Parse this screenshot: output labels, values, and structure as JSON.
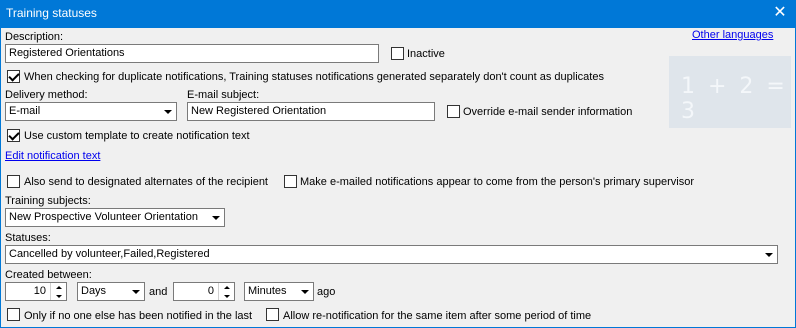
{
  "window": {
    "title": "Training statuses"
  },
  "form": {
    "description_label": "Description:",
    "description_value": "Registered Orientations",
    "inactive_label": "Inactive",
    "other_languages_link": "Other languages",
    "logo_text": "1 + 2 = 3",
    "duplicate_label": "When checking for duplicate notifications, Training statuses notifications generated separately don't count as duplicates",
    "delivery_label": "Delivery method:",
    "delivery_value": "E-mail",
    "subject_label": "E-mail subject:",
    "subject_value": "New Registered Orientation",
    "override_label": "Override e-mail sender information",
    "custom_template_label": "Use custom template to create notification text",
    "edit_text_link": "Edit notification text",
    "alternates_label": "Also send to designated alternates of the recipient",
    "supervisor_label": "Make e-mailed notifications appear to come from the person's primary supervisor",
    "training_subjects_label": "Training subjects:",
    "training_subjects_value": "New Prospective Volunteer Orientation",
    "statuses_label": "Statuses:",
    "statuses_value": "Cancelled by volunteer,Failed,Registered",
    "created_between_label": "Created between:",
    "from_value": "10",
    "from_unit": "Days",
    "and_label": "and",
    "to_value": "0",
    "to_unit": "Minutes",
    "ago_label": "ago",
    "only_if_label": "Only if no one else has been notified in the last",
    "allow_renotify_label": "Allow re-notification for the same item after some period of time"
  },
  "state": {
    "inactive": false,
    "duplicate": true,
    "override": false,
    "custom_template": true,
    "alternates": false,
    "supervisor": false,
    "only_if": false,
    "allow_renotify": false
  },
  "colors": {
    "titlebar": "#0078d7",
    "client": "#f0f0f0",
    "link": "#0000ee"
  },
  "icons": {
    "close": "close-icon",
    "dropdown": "chevron-down-icon"
  }
}
